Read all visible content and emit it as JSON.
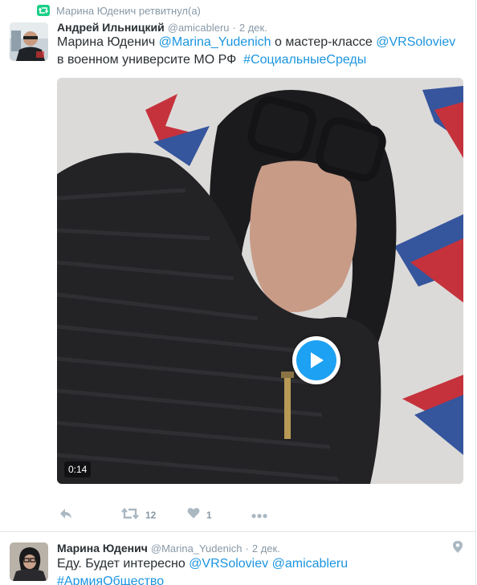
{
  "retweet_context": {
    "label": "Марина Юденич ретвитнул(а)",
    "icon": "retweet-icon",
    "color": "#19cf86"
  },
  "tweet1": {
    "fullname": "Андрей Ильницкий",
    "username": "@amicableru",
    "separator": "·",
    "time": "2 дек.",
    "text_part1": "Марина Юденич ",
    "mention1": "@Marina_Yudenich",
    "text_part2": " о мастер-классе ",
    "mention2": "@VRSoloviev",
    "text_part3": "в военном университе МО РФ  ",
    "hashtag": "#СоциальныеСреды",
    "media": {
      "type": "video",
      "duration": "0:14",
      "play_icon": "play-icon"
    },
    "actions": {
      "reply_icon": "reply-icon",
      "retweet_icon": "retweet-icon",
      "retweet_count": "12",
      "like_icon": "heart-icon",
      "like_count": "1",
      "more_icon": "more-icon"
    }
  },
  "tweet2": {
    "fullname": "Марина Юденич",
    "username": "@Marina_Yudenich",
    "separator": "·",
    "time": "2 дек.",
    "text_part1": "Еду. Будет интересно ",
    "mention1": "@VRSoloviev",
    "space": " ",
    "mention2": "@amicableru",
    "hashtag": "#АрмияОбщество",
    "geo_icon": "location-pin-icon"
  },
  "colors": {
    "link": "#1b95e0",
    "muted": "#8899a6",
    "text": "#292f33",
    "play": "#1da1f2"
  }
}
